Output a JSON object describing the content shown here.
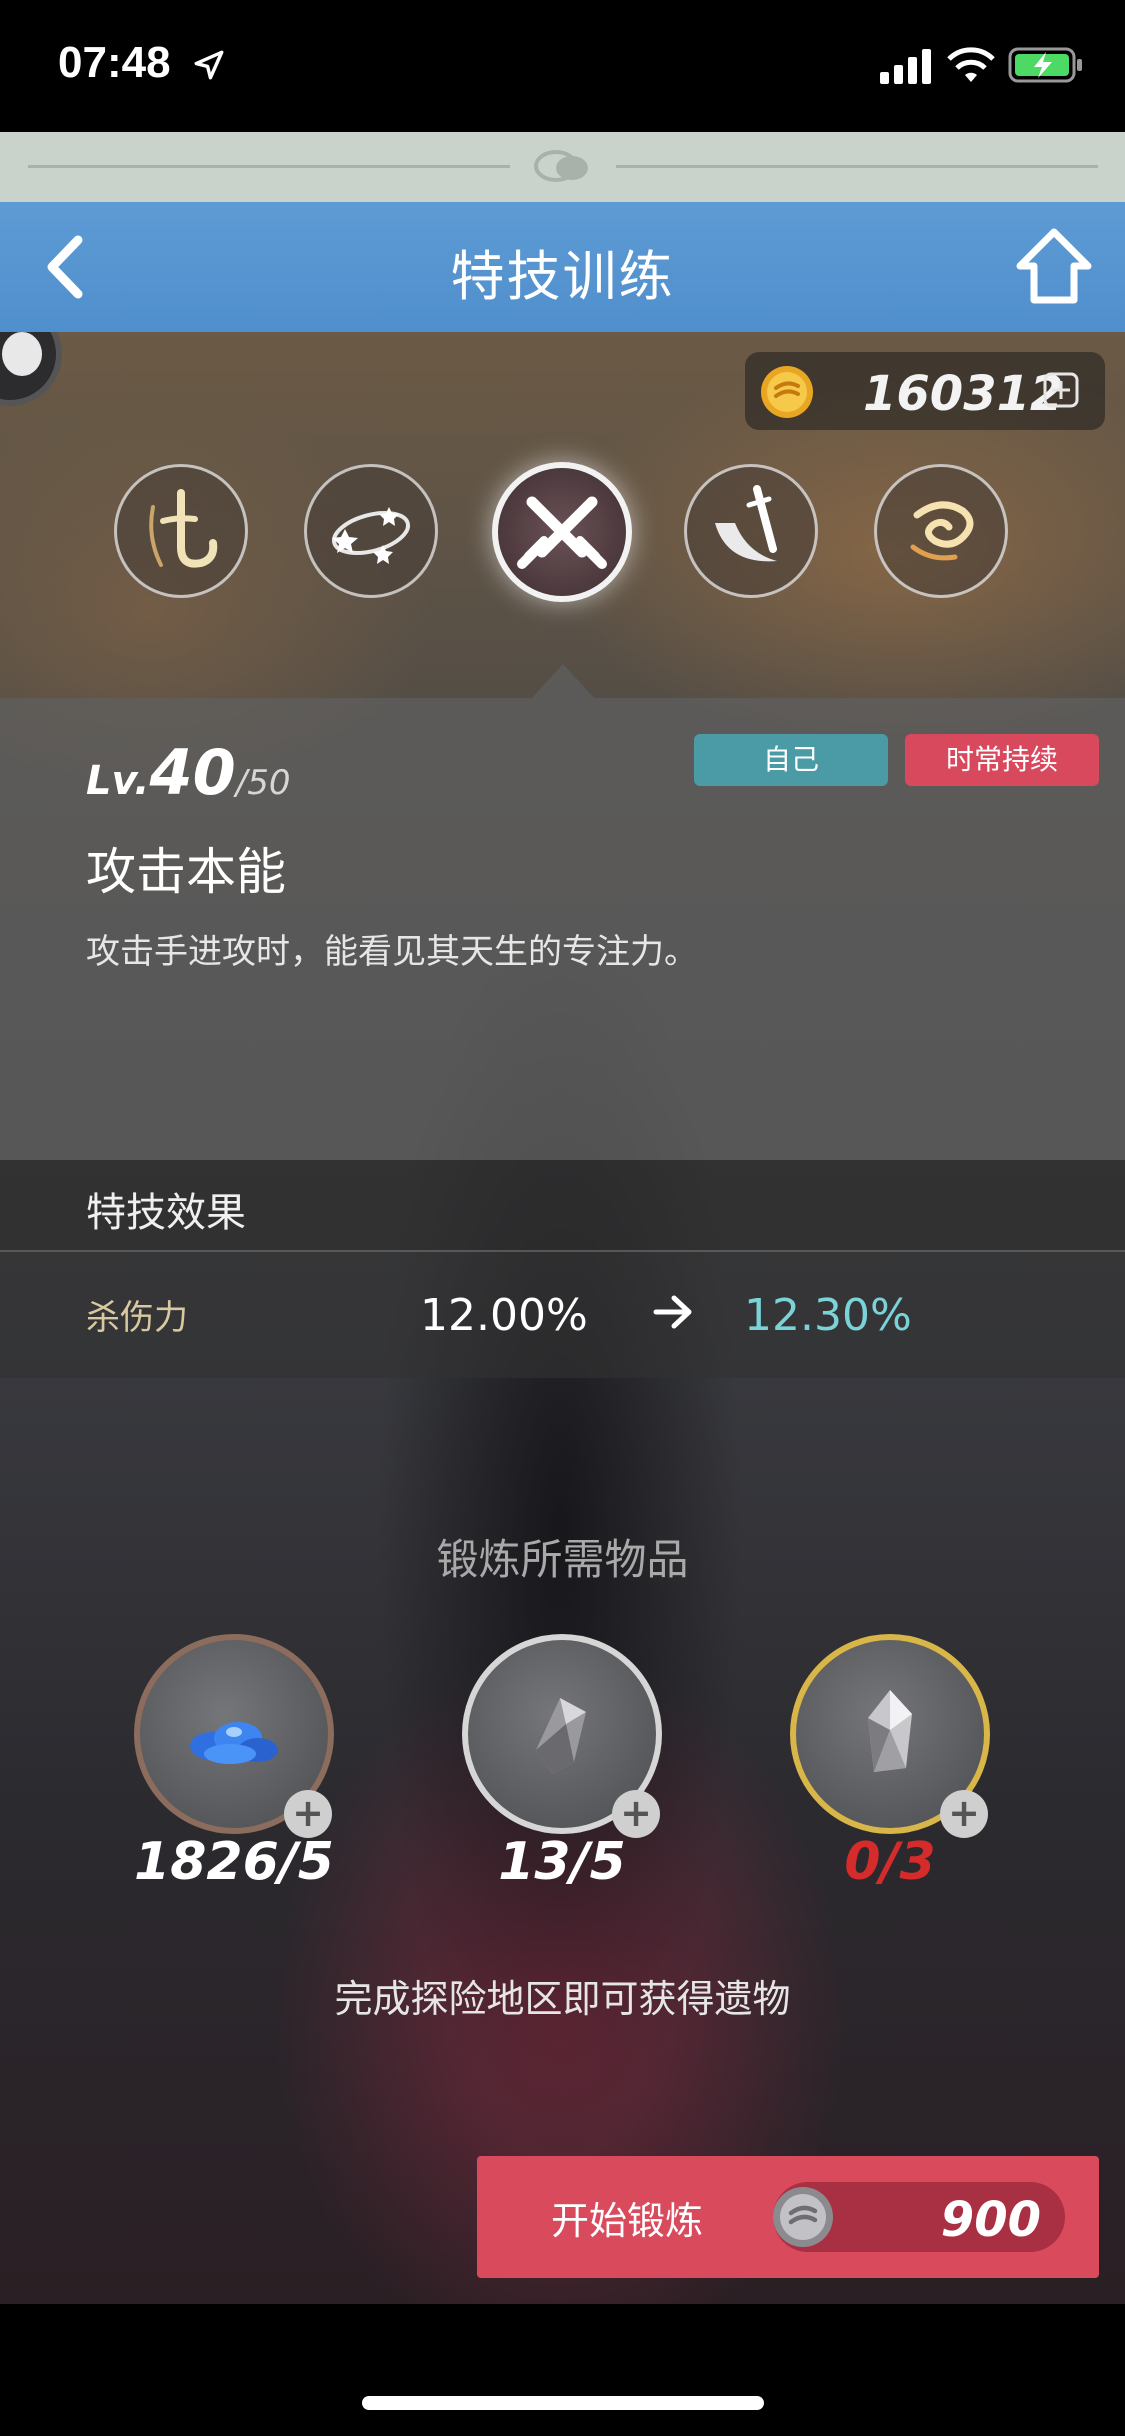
{
  "status_bar": {
    "time": "07:48",
    "location_icon": "location-arrow-icon",
    "signal_icon": "cellular-signal-icon",
    "wifi_icon": "wifi-icon",
    "battery_icon": "battery-charging-icon"
  },
  "chat_bar": {
    "icon": "chat-bubbles-icon"
  },
  "header": {
    "title": "特技训练",
    "back_icon": "chevron-left-icon",
    "home_icon": "home-icon"
  },
  "currency": {
    "value": "160312",
    "icon": "gold-coin-icon",
    "add_icon": "plus-box-icon"
  },
  "skill_tabs": [
    {
      "name": "skill-1",
      "icon": "hook-glyph-icon",
      "selected": false
    },
    {
      "name": "skill-2",
      "icon": "stars-orbit-icon",
      "selected": false
    },
    {
      "name": "skill-3",
      "icon": "crossed-swords-icon",
      "selected": true
    },
    {
      "name": "skill-4",
      "icon": "sword-slash-icon",
      "selected": false
    },
    {
      "name": "skill-5",
      "icon": "fire-swirl-icon",
      "selected": false
    }
  ],
  "skill": {
    "level_prefix": "Lv.",
    "level": "40",
    "level_max": "/50",
    "tag_target": "自己",
    "tag_duration": "时常持续",
    "name": "攻击本能",
    "description": "攻击手进攻时，能看见其天生的专注力。"
  },
  "effect": {
    "title": "特技效果",
    "stat_name": "杀伤力",
    "before": "12.00%",
    "after": "12.30%",
    "arrow_icon": "arrow-right-icon"
  },
  "requirements": {
    "title": "锻炼所需物品",
    "items": [
      {
        "icon": "blue-crystal-pile-icon",
        "count": "1826/5"
      },
      {
        "icon": "gray-shard-icon",
        "count": "13/5"
      },
      {
        "icon": "silver-crystal-icon",
        "count": "0/3"
      }
    ],
    "hint": "完成探险地区即可获得遗物"
  },
  "start_button": {
    "label": "开始锻炼",
    "cost": "900",
    "cost_icon": "silver-coin-icon"
  },
  "colors": {
    "header_blue": "#5e9bd5",
    "tag_teal": "#4a9ba6",
    "tag_red": "#d8495d",
    "stat_after_cyan": "#7ad3d6",
    "insufficient_red": "#d62b2b",
    "start_button_red": "#d94a5d"
  }
}
